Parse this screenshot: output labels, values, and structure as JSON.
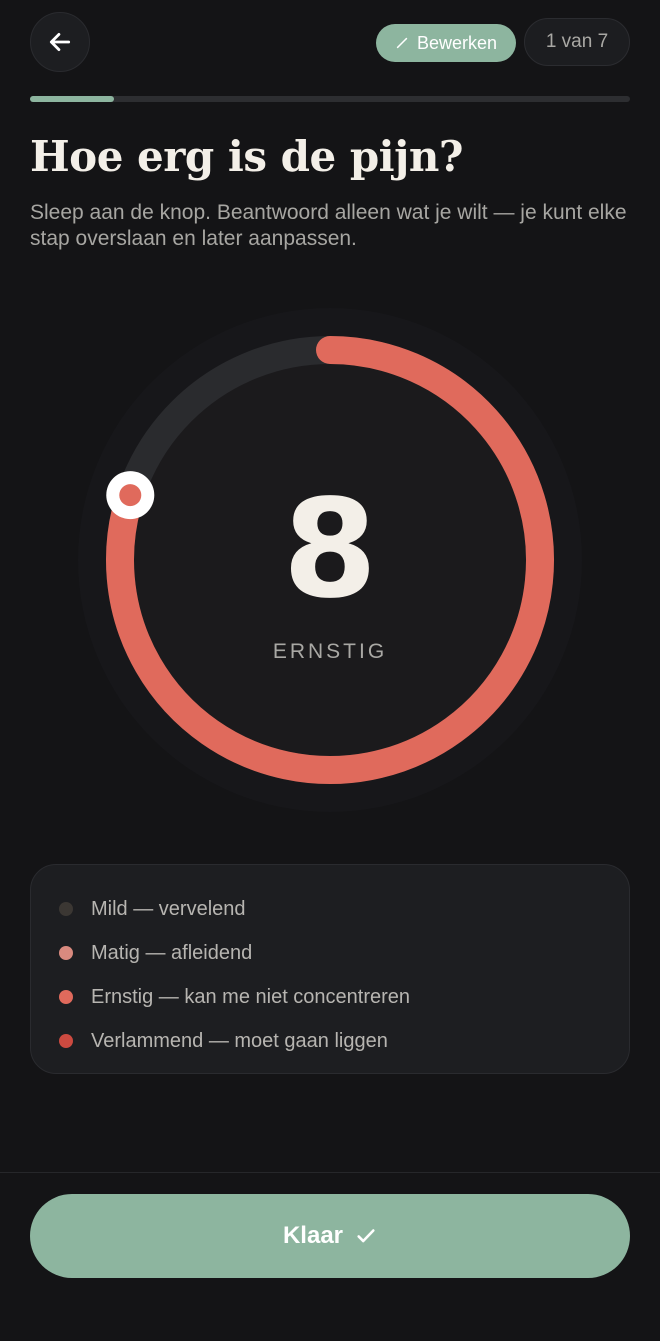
{
  "header": {
    "back_icon": "arrow-left-icon",
    "edit_label": "Bewerken",
    "edit_icon": "pencil-icon",
    "step_label": "1 van 7"
  },
  "progress": {
    "value": 0.14,
    "color": "#8db59f"
  },
  "question": {
    "title": "Hoe erg is de pijn?",
    "subtitle": "Sleep aan de knop. Beantwoord alleen wat je wilt — je kunt elke stap overslaan en later aanpassen."
  },
  "dial": {
    "value": "8",
    "fraction": 0.8,
    "label": "ERNSTIG",
    "accent": "#e06a5c"
  },
  "legend": {
    "items": [
      {
        "label": "Mild — vervelend",
        "color": "#3b3733"
      },
      {
        "label": "Matig — afleidend",
        "color": "#d98a7f"
      },
      {
        "label": "Ernstig — kan me niet concentreren",
        "color": "#e06a5c"
      },
      {
        "label": "Verlammend — moet gaan liggen",
        "color": "#cc4a40"
      }
    ]
  },
  "footer": {
    "done_label": "Klaar",
    "done_icon": "check-icon"
  }
}
